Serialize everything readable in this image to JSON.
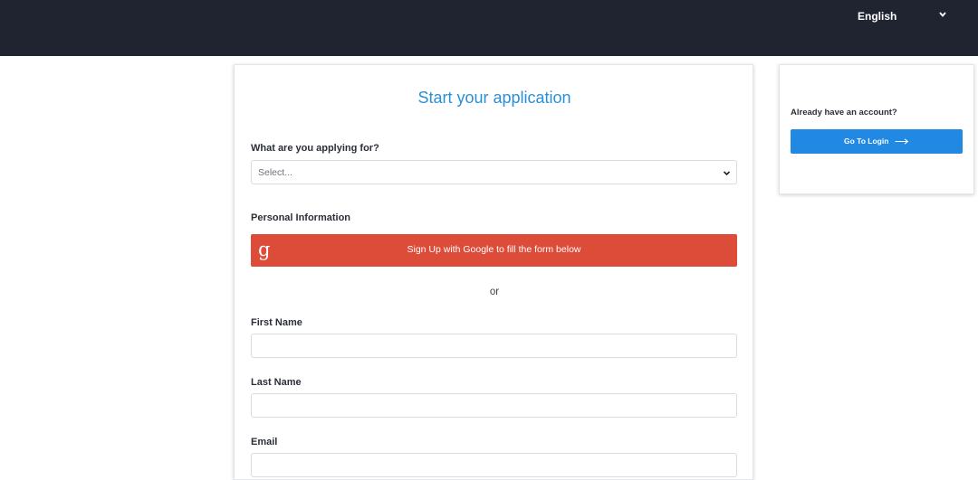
{
  "header": {
    "language": {
      "label": "English",
      "icon": "chevron-down-icon"
    }
  },
  "form": {
    "title": "Start your application",
    "applying_for": {
      "label": "What are you applying for?",
      "placeholder": "Select..."
    },
    "personal_info_label": "Personal Information",
    "google_button": {
      "label": "Sign Up with Google to fill the form below",
      "icon_glyph": "g",
      "color": "#dd4b39"
    },
    "or_text": "or",
    "first_name": {
      "label": "First Name",
      "value": ""
    },
    "last_name": {
      "label": "Last Name",
      "value": ""
    },
    "email": {
      "label": "Email",
      "value": ""
    }
  },
  "sidebar": {
    "prompt": "Already have an account?",
    "login_button": {
      "label": "Go To Login",
      "color": "#2188e3",
      "icon": "arrow-right-icon"
    }
  },
  "colors": {
    "topbar": "#1f2430",
    "accent": "#2b8fd6"
  }
}
